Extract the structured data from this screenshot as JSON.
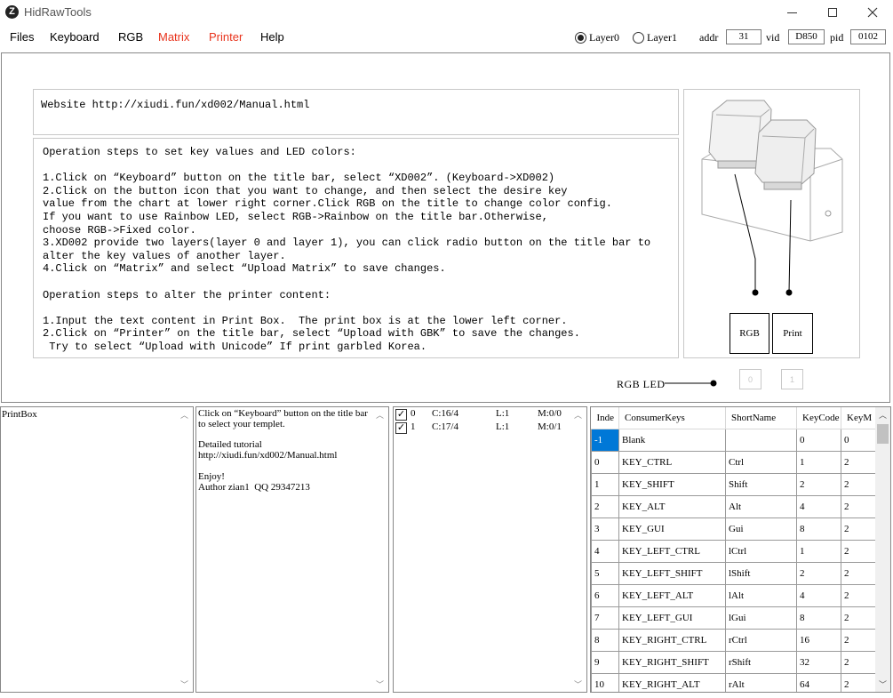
{
  "window": {
    "title": "HidRawTools",
    "icon_letter": "Z",
    "minimize": "—",
    "maximize": "☐",
    "close": "✕"
  },
  "menu": {
    "files": "Files",
    "keyboard": "Keyboard",
    "rgb": "RGB",
    "matrix": "Matrix",
    "printer": "Printer",
    "help": "Help",
    "accent_color": "#e8331c"
  },
  "device": {
    "layer0": "Layer0",
    "layer1": "Layer1",
    "layer0_selected": true,
    "addr_label": "addr",
    "addr_value": "31",
    "vid_label": "vid",
    "vid_value": "D850",
    "pid_label": "pid",
    "pid_value": "0102"
  },
  "info": {
    "website": "Website http://xiudi.fun/xd002/Manual.html",
    "steps": "Operation steps to set key values and LED colors:\n\n1.Click on “Keyboard” button on the title bar, select “XD002”. (Keyboard->XD002)\n2.Click on the button icon that you want to change, and then select the desire key\nvalue from the chart at lower right corner.Click RGB on the title to change color config.\nIf you want to use Rainbow LED, select RGB->Rainbow on the title bar.Otherwise,\nchoose RGB->Fixed color.\n3.XD002 provide two layers(layer 0 and layer 1), you can click radio button on the title bar to\nalter the key values of another layer.\n4.Click on “Matrix” and select “Upload Matrix” to save changes.\n\nOperation steps to alter the printer content:\n\n1.Input the text content in Print Box.  The print box is at the lower left corner.\n2.Click on “Printer” on the title bar, select “Upload with GBK” to save the changes.\n Try to select “Upload with Unicode” If print garbled Korea.",
    "rgb_button": "RGB",
    "print_button": "Print",
    "rgb_led_label": "RGB LED",
    "small_key_0": "0",
    "small_key_1": "1"
  },
  "printbox": {
    "text": "PrintBox"
  },
  "help_panel": {
    "text": "Click on “Keyboard” button on the title bar to select your templet.\n\nDetailed tutorial\nhttp://xiudi.fun/xd002/Manual.html\n\nEnjoy!\nAuthor zian1  QQ 29347213"
  },
  "matrix_list": [
    {
      "checked": true,
      "index": "0",
      "c": "C:16/4",
      "l": "L:1",
      "m": "M:0/0"
    },
    {
      "checked": true,
      "index": "1",
      "c": "C:17/4",
      "l": "L:1",
      "m": "M:0/1"
    }
  ],
  "key_table": {
    "headers": [
      "Inde",
      "ConsumerKeys",
      "ShortName",
      "KeyCode",
      "KeyM"
    ],
    "rows": [
      [
        "-1",
        "Blank",
        "",
        "0",
        "0"
      ],
      [
        "0",
        "KEY_CTRL",
        "Ctrl",
        "1",
        "2"
      ],
      [
        "1",
        "KEY_SHIFT",
        "Shift",
        "2",
        "2"
      ],
      [
        "2",
        "KEY_ALT",
        "Alt",
        "4",
        "2"
      ],
      [
        "3",
        "KEY_GUI",
        "Gui",
        "8",
        "2"
      ],
      [
        "4",
        "KEY_LEFT_CTRL",
        "lCtrl",
        "1",
        "2"
      ],
      [
        "5",
        "KEY_LEFT_SHIFT",
        "lShift",
        "2",
        "2"
      ],
      [
        "6",
        "KEY_LEFT_ALT",
        "lAlt",
        "4",
        "2"
      ],
      [
        "7",
        "KEY_LEFT_GUI",
        "lGui",
        "8",
        "2"
      ],
      [
        "8",
        "KEY_RIGHT_CTRL",
        "rCtrl",
        "16",
        "2"
      ],
      [
        "9",
        "KEY_RIGHT_SHIFT",
        "rShift",
        "32",
        "2"
      ],
      [
        "10",
        "KEY_RIGHT_ALT",
        "rAlt",
        "64",
        "2"
      ]
    ]
  }
}
